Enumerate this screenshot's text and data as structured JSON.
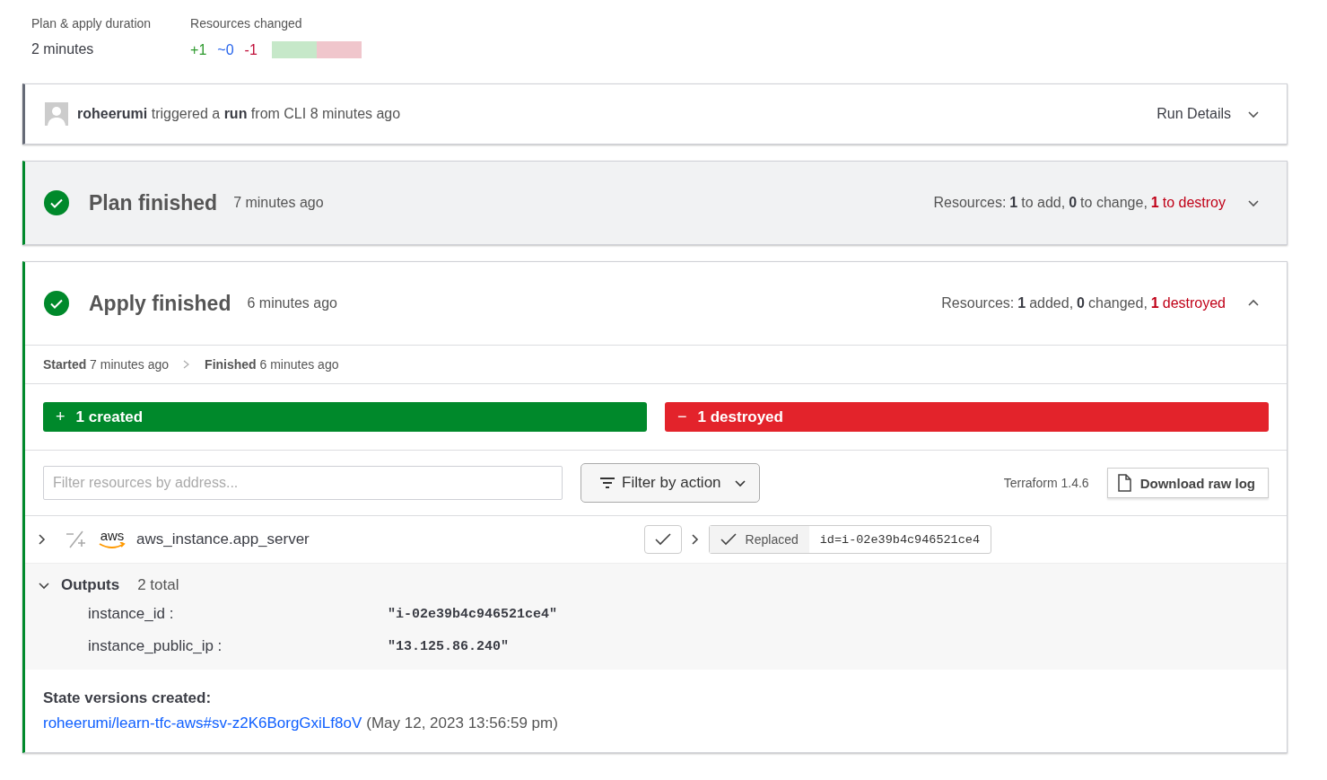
{
  "summary": {
    "duration_label": "Plan & apply duration",
    "duration": "2 minutes",
    "changed_label": "Resources changed",
    "added": "+1",
    "changed": "~0",
    "destroyed": "-1"
  },
  "trigger": {
    "user": "roheerumi",
    "text_1": "triggered a",
    "run": "run",
    "text_2": "from CLI 8 minutes ago",
    "details": "Run Details",
    "expanded": false
  },
  "plan": {
    "title": "Plan finished",
    "time": "7 minutes ago",
    "expanded": false,
    "resources": [
      {
        "text": "Resources:",
        "kind": "plain"
      },
      {
        "text": "1",
        "kind": "count"
      },
      {
        "text": "to add,",
        "kind": "plain"
      },
      {
        "text": "0",
        "kind": "count"
      },
      {
        "text": "to change,",
        "kind": "plain"
      },
      {
        "text": "1",
        "kind": "destroy-count"
      },
      {
        "text": "to destroy",
        "kind": "destroy"
      }
    ]
  },
  "apply": {
    "title": "Apply finished",
    "time": "6 minutes ago",
    "expanded": true,
    "resources": [
      {
        "text": "Resources:",
        "kind": "plain"
      },
      {
        "text": "1",
        "kind": "count"
      },
      {
        "text": "added,",
        "kind": "plain"
      },
      {
        "text": "0",
        "kind": "count"
      },
      {
        "text": "changed,",
        "kind": "plain"
      },
      {
        "text": "1",
        "kind": "destroy-count"
      },
      {
        "text": "destroyed",
        "kind": "destroy"
      }
    ],
    "started_label": "Started",
    "started": "7 minutes ago",
    "finished_label": "Finished",
    "finished": "6 minutes ago",
    "totals": [
      {
        "kind": "created",
        "sign": "+",
        "label": "1 created"
      },
      {
        "kind": "destroyed",
        "sign": "−",
        "label": "1 destroyed"
      }
    ],
    "filter": {
      "placeholder": "Filter resources by address...",
      "action": "Filter by action"
    },
    "version": "Terraform 1.4.6",
    "download": "Download raw log",
    "resource": {
      "expanded": false,
      "provider": "aws",
      "address": "aws_instance.app_server",
      "status": "Replaced",
      "id": "id=i-02e39b4c946521ce4"
    },
    "outputs": {
      "expanded": true,
      "label": "Outputs",
      "total": "2 total",
      "items": [
        {
          "key": "instance_id :",
          "value": "\"i-02e39b4c946521ce4\""
        },
        {
          "key": "instance_public_ip :",
          "value": "\"13.125.86.240\""
        }
      ]
    },
    "state_label": "State versions created:",
    "state_link": "roheerumi/learn-tfc-aws#sv-z2K6BorgGxiLf8oV",
    "state_date": "(May 12, 2023 13:56:59 pm)"
  }
}
